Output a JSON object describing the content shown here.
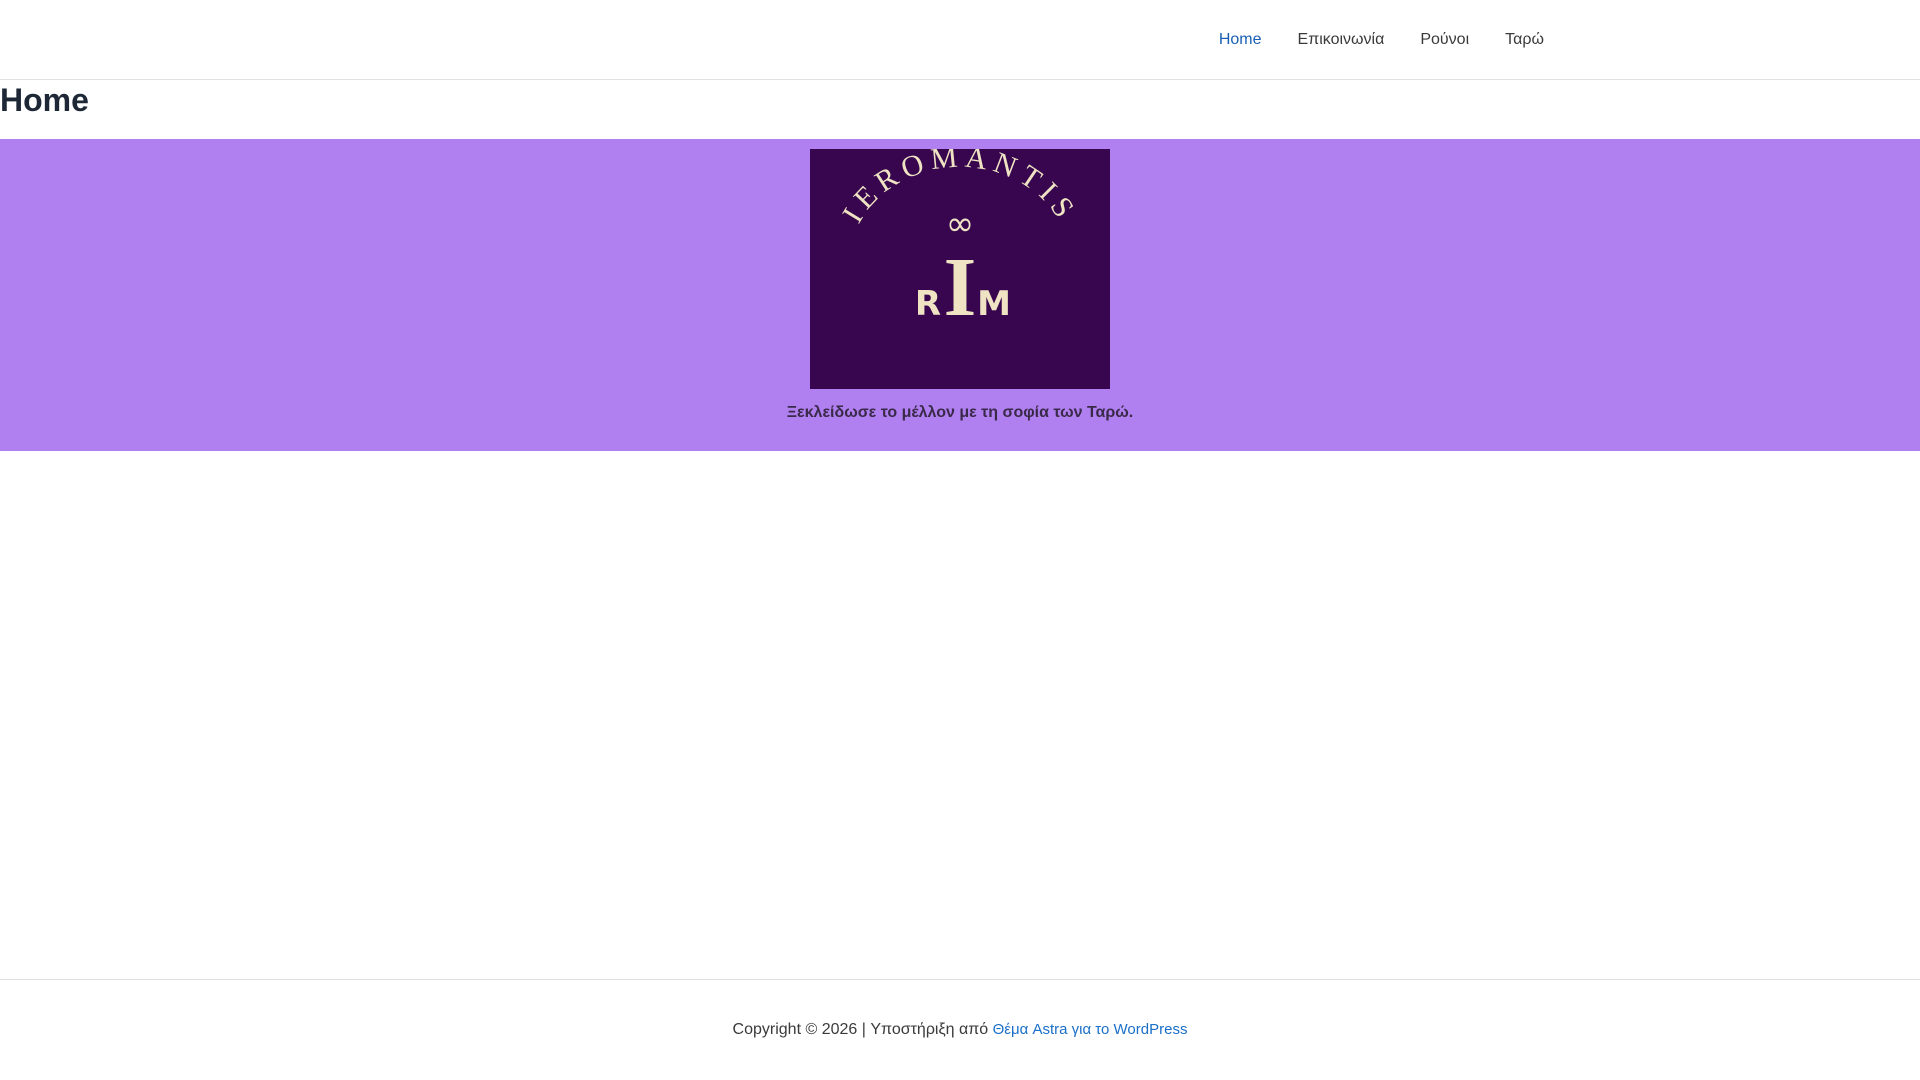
{
  "nav": {
    "items": [
      {
        "label": "Home",
        "active": true
      },
      {
        "label": "Επικοινωνία",
        "active": false
      },
      {
        "label": "Ρούνοι",
        "active": false
      },
      {
        "label": "Ταρώ",
        "active": false
      }
    ]
  },
  "page": {
    "title": "Home"
  },
  "hero": {
    "logo_arc_text": "IEROMANTIS",
    "logo_symbol": "∞",
    "logo_letter_left": "R",
    "logo_letter_center": "I",
    "logo_letter_right": "M",
    "tagline": "Ξεκλείδωσε το μέλλον με τη σοφία των Ταρώ."
  },
  "footer": {
    "copyright": "Copyright © 2026 | Υποστήριξη από ",
    "link_label": "Θέμα Astra για το WordPress"
  },
  "colors": {
    "hero_bg": "#b07ff0",
    "logo_bg": "#37064e",
    "logo_fg": "#efe3c4",
    "link": "#1a6fc9"
  }
}
